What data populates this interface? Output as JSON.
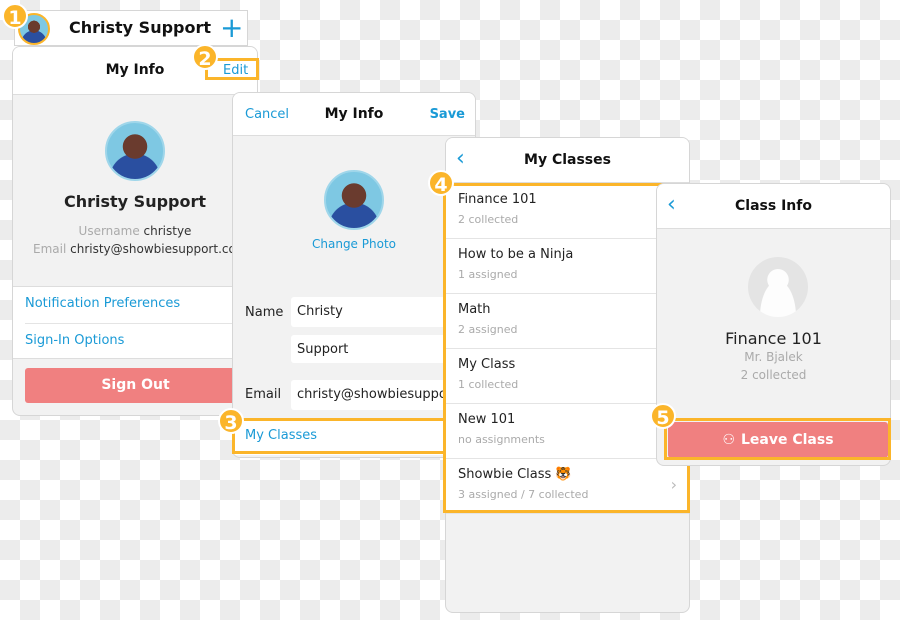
{
  "steps": [
    "1",
    "2",
    "3",
    "4",
    "5"
  ],
  "account_bar": {
    "name": "Christy Support",
    "add_icon": "plus-icon"
  },
  "my_info": {
    "title": "My Info",
    "edit": "Edit",
    "name": "Christy Support",
    "username_label": "Username",
    "username": "christye",
    "email_label": "Email",
    "email": "christy@showbiesupport.com",
    "links": [
      "Notification Preferences",
      "Sign-In Options"
    ],
    "sign_out": "Sign Out"
  },
  "edit_info": {
    "cancel": "Cancel",
    "title": "My Info",
    "save": "Save",
    "change_photo": "Change Photo",
    "name_label": "Name",
    "first_name": "Christy",
    "last_name": "Support",
    "email_label": "Email",
    "email": "christy@showbiesupport.com",
    "my_classes": "My Classes"
  },
  "my_classes": {
    "title": "My Classes",
    "items": [
      {
        "name": "Finance 101",
        "status": "2 collected"
      },
      {
        "name": "How to be a Ninja",
        "status": "1 assigned"
      },
      {
        "name": "Math",
        "status": "2 assigned"
      },
      {
        "name": "My Class",
        "status": "1 collected"
      },
      {
        "name": "New 101",
        "status": "no assignments"
      },
      {
        "name": "Showbie Class 🐯",
        "status": "3 assigned / 7 collected"
      }
    ]
  },
  "class_info": {
    "title": "Class Info",
    "class_name": "Finance 101",
    "teacher": "Mr. Bjalek",
    "status": "2 collected",
    "leave": "Leave Class"
  },
  "colors": {
    "accent": "#1a9ad6",
    "highlight": "#fbb52a",
    "danger": "#f08080"
  }
}
